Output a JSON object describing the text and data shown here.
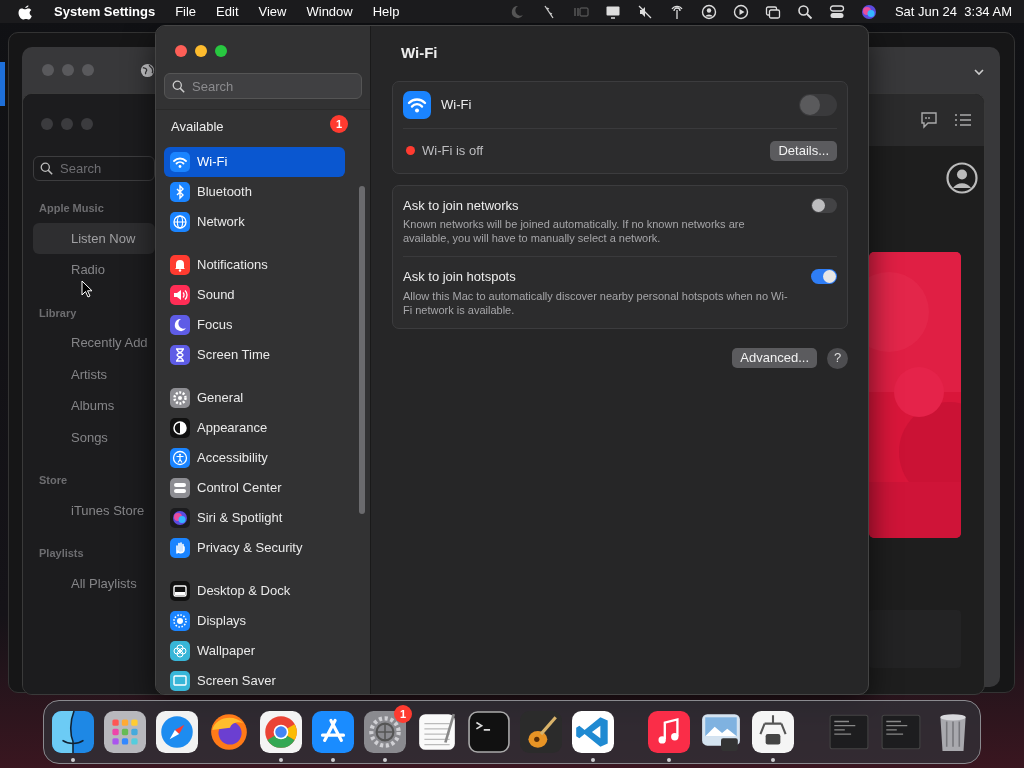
{
  "menu_bar": {
    "app_name": "System Settings",
    "menus": [
      "File",
      "Edit",
      "View",
      "Window",
      "Help"
    ],
    "clock": "Sat Jun 24  3:34 AM"
  },
  "music_window": {
    "search": {
      "placeholder": "Search"
    },
    "sections": [
      {
        "heading": "Apple Music",
        "items": [
          {
            "label": "Listen Now",
            "selected": true
          },
          {
            "label": "Radio",
            "selected": false
          }
        ]
      },
      {
        "heading": "Library",
        "items": [
          {
            "label": "Recently Add",
            "selected": false
          },
          {
            "label": "Artists",
            "selected": false
          },
          {
            "label": "Albums",
            "selected": false
          },
          {
            "label": "Songs",
            "selected": false
          }
        ]
      },
      {
        "heading": "Store",
        "items": [
          {
            "label": "iTunes Store",
            "selected": false
          }
        ]
      },
      {
        "heading": "Playlists",
        "items": [
          {
            "label": "All Playlists",
            "selected": false
          }
        ]
      }
    ]
  },
  "settings_window": {
    "search": {
      "placeholder": "Search"
    },
    "update_notice": {
      "label": "Available",
      "badge": "1"
    },
    "sidebar": [
      [
        {
          "kind": "wifi",
          "label": "Wi-Fi",
          "selected": true
        },
        {
          "kind": "bluetooth",
          "label": "Bluetooth",
          "selected": false
        },
        {
          "kind": "network",
          "label": "Network",
          "selected": false
        }
      ],
      [
        {
          "kind": "notifications",
          "label": "Notifications",
          "selected": false
        },
        {
          "kind": "sound",
          "label": "Sound",
          "selected": false
        },
        {
          "kind": "focus",
          "label": "Focus",
          "selected": false
        },
        {
          "kind": "screentime",
          "label": "Screen Time",
          "selected": false
        }
      ],
      [
        {
          "kind": "general",
          "label": "General",
          "selected": false
        },
        {
          "kind": "appearance",
          "label": "Appearance",
          "selected": false
        },
        {
          "kind": "accessibility",
          "label": "Accessibility",
          "selected": false
        },
        {
          "kind": "controlcenter",
          "label": "Control Center",
          "selected": false
        },
        {
          "kind": "siri",
          "label": "Siri & Spotlight",
          "selected": false
        },
        {
          "kind": "privacy",
          "label": "Privacy & Security",
          "selected": false
        }
      ],
      [
        {
          "kind": "desktop",
          "label": "Desktop & Dock",
          "selected": false
        },
        {
          "kind": "displays",
          "label": "Displays",
          "selected": false
        },
        {
          "kind": "wallpaper",
          "label": "Wallpaper",
          "selected": false
        },
        {
          "kind": "screensaver",
          "label": "Screen Saver",
          "selected": false
        }
      ]
    ],
    "pane": {
      "title": "Wi-Fi",
      "wifi": {
        "label": "Wi-Fi",
        "on": false
      },
      "status": "Wi-Fi is off",
      "details_button": "Details...",
      "options": [
        {
          "title": "Ask to join networks",
          "description": "Known networks will be joined automatically. If no known networks are available, you will have to manually select a network.",
          "on": false
        },
        {
          "title": "Ask to join hotspots",
          "description": "Allow this Mac to automatically discover nearby personal hotspots when no Wi-Fi network is available.",
          "on": true
        }
      ],
      "advanced_button": "Advanced...",
      "help_button": "?"
    }
  },
  "dock": {
    "sections": [
      [
        {
          "kind": "finder",
          "running": true
        },
        {
          "kind": "launchpad",
          "running": false
        },
        {
          "kind": "safari",
          "running": false
        },
        {
          "kind": "firefox",
          "running": false
        },
        {
          "kind": "chrome",
          "running": true
        },
        {
          "kind": "appstore",
          "running": true
        },
        {
          "kind": "settings",
          "running": true,
          "badge": "1"
        },
        {
          "kind": "textedit",
          "running": false
        },
        {
          "kind": "terminal",
          "running": false
        },
        {
          "kind": "garageband",
          "running": false
        },
        {
          "kind": "vscode",
          "running": true
        }
      ],
      [
        {
          "kind": "music",
          "running": true
        },
        {
          "kind": "preview",
          "running": false
        },
        {
          "kind": "claw",
          "running": true
        }
      ],
      [
        {
          "kind": "thumb",
          "running": false
        },
        {
          "kind": "thumb",
          "running": false
        },
        {
          "kind": "trash",
          "running": false
        }
      ]
    ]
  }
}
